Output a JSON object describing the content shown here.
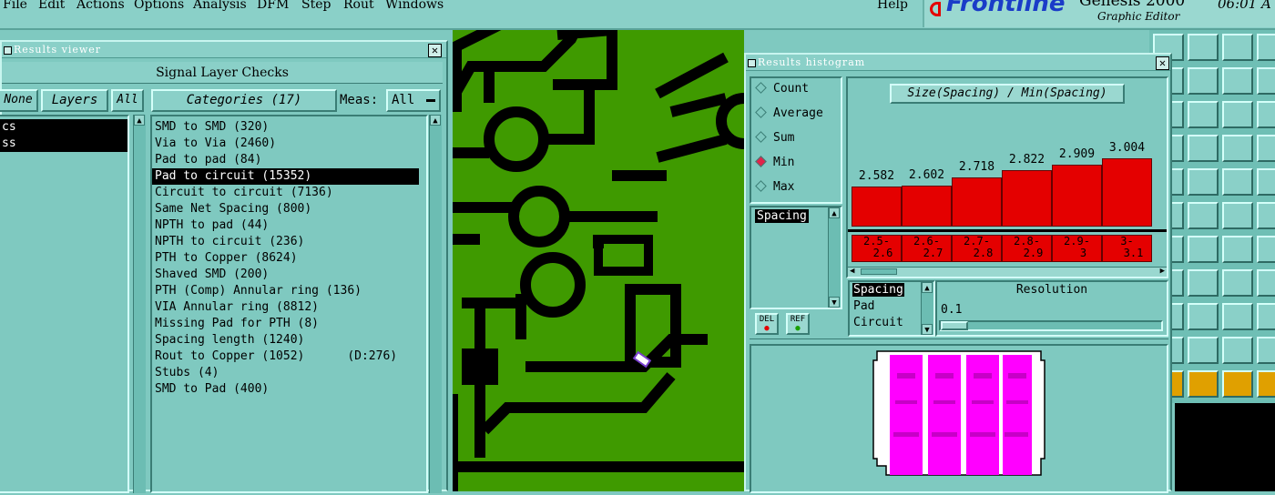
{
  "menubar": {
    "items": [
      "File",
      "Edit",
      "Actions",
      "Options",
      "Analysis",
      "DFM",
      "Step",
      "Rout",
      "Windows"
    ],
    "help": "Help",
    "brand": "Frontline",
    "product": "Genesis 2000",
    "subtitle": "Graphic Editor",
    "clock": "06:01 A"
  },
  "results_viewer": {
    "title": "Results viewer",
    "header": "Signal Layer Checks",
    "none_btn": "None",
    "layers_btn": "Layers",
    "all_btn": "All",
    "layers": [
      "cs",
      "ss"
    ],
    "categories_btn": "Categories (17)",
    "meas_label": "Meas:",
    "meas_value": "All",
    "categories": [
      "SMD to SMD (320)",
      "Via to Via (2460)",
      "Pad to pad (84)",
      "Pad to circuit (15352)",
      "Circuit to circuit (7136)",
      "Same Net Spacing (800)",
      "NPTH to pad (44)",
      "NPTH to circuit (236)",
      "PTH to Copper (8624)",
      "Shaved SMD (200)",
      "PTH (Comp) Annular ring (136)",
      "VIA Annular ring (8812)",
      "Missing Pad for PTH (8)",
      "Spacing length (1240)",
      "Rout to Copper (1052)      (D:276)",
      "Stubs (4)",
      "SMD to Pad (400)"
    ],
    "selected_index": 3
  },
  "histogram": {
    "title": "Results histogram",
    "modes": [
      "Count",
      "Average",
      "Sum",
      "Min",
      "Max"
    ],
    "selected_mode": "Min",
    "measure_list": [
      "Spacing"
    ],
    "del_btn": "DEL",
    "ref_btn": "REF",
    "chart_title": "Size(Spacing) / Min(Spacing)",
    "bar_values": [
      "2.582",
      "2.602",
      "2.718",
      "2.822",
      "2.909",
      "3.004"
    ],
    "bin_labels": [
      [
        "2.5-",
        "2.6"
      ],
      [
        "2.6-",
        "2.7"
      ],
      [
        "2.7-",
        "2.8"
      ],
      [
        "2.8-",
        "2.9"
      ],
      [
        "2.9-",
        "3"
      ],
      [
        "3-",
        "3.1"
      ]
    ],
    "size_list": [
      "Spacing",
      "Pad",
      "Circuit"
    ],
    "resolution_label": "Resolution",
    "resolution_value": "0.1",
    "colors": {
      "bar": "#e40000",
      "preview": "#ff00ff"
    }
  },
  "canvas": {
    "colors": {
      "board": "#3f9a00",
      "copper": "#000000"
    }
  }
}
